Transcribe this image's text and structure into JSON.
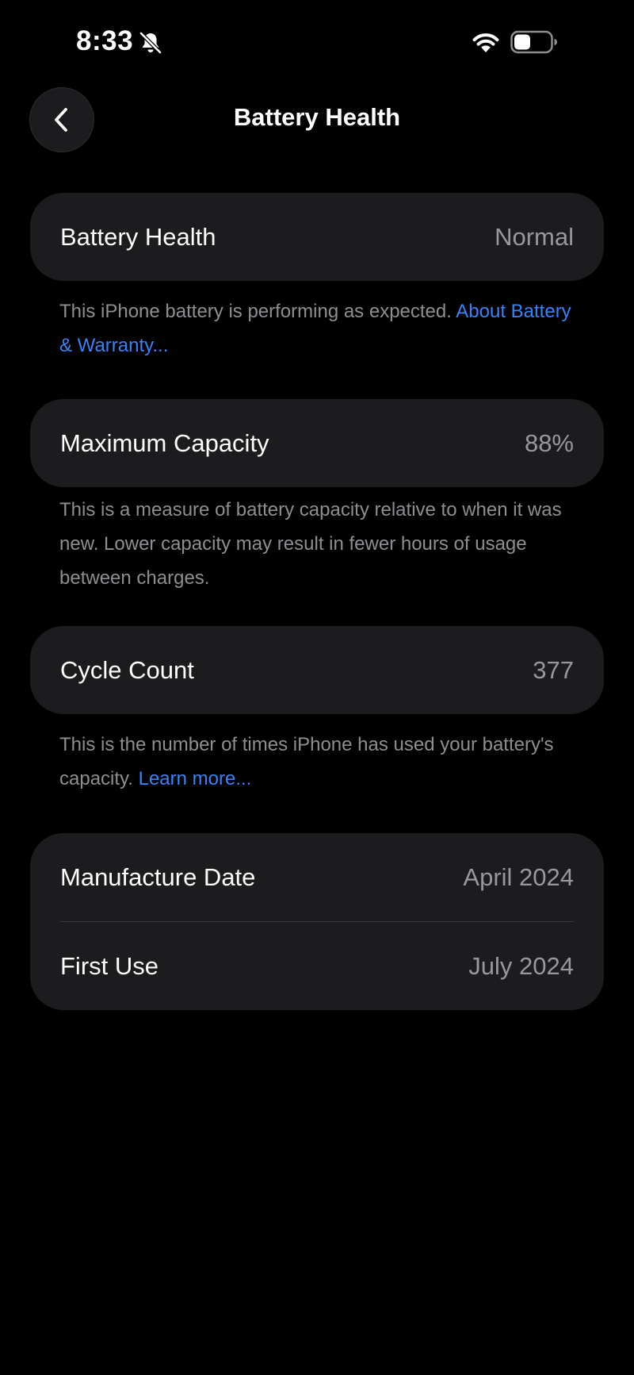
{
  "status_bar": {
    "time": "8:33",
    "icons": [
      "bell-slash-icon",
      "wifi-icon",
      "battery-icon"
    ],
    "battery_level_fraction": 0.45
  },
  "nav": {
    "title": "Battery Health",
    "back_icon": "chevron-left-icon"
  },
  "battery_health": {
    "label": "Battery Health",
    "value": "Normal",
    "footer_text": "This iPhone battery is performing as expected. ",
    "footer_link": "About Battery & Warranty..."
  },
  "maximum_capacity": {
    "label": "Maximum Capacity",
    "value": "88%",
    "footer_text": "This is a measure of battery capacity relative to when it was new. Lower capacity may result in fewer hours of usage between charges."
  },
  "cycle_count": {
    "label": "Cycle Count",
    "value": "377",
    "footer_text": "This is the number of times iPhone has used your battery's capacity. ",
    "footer_link": "Learn more..."
  },
  "dates": {
    "manufacture_label": "Manufacture Date",
    "manufacture_value": "April 2024",
    "first_use_label": "First Use",
    "first_use_value": "July 2024"
  },
  "colors": {
    "background": "#000000",
    "card": "#1c1c1e",
    "secondary_text": "#8e8e93",
    "link": "#3a82f7"
  }
}
